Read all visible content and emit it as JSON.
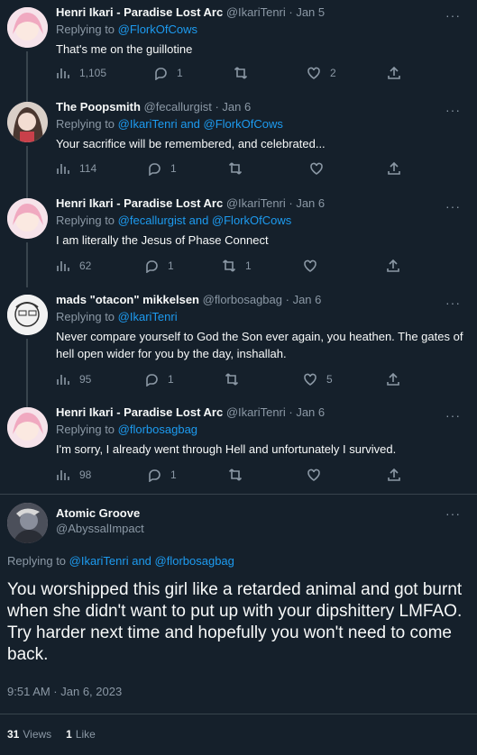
{
  "tweets": [
    {
      "name": "Henri Ikari - Paradise Lost Arc",
      "handle": "@IkariTenri",
      "date": "· Jan 5",
      "replying_to_prefix": "Replying to",
      "replying_to": "@FlorkOfCows",
      "text": "That's me on the guillotine",
      "views": "1,105",
      "replies": "1",
      "retweets": "",
      "likes": "2"
    },
    {
      "name": "The Poopsmith",
      "handle": "@fecallurgist",
      "date": "· Jan 6",
      "replying_to_prefix": "Replying to",
      "replying_to": "@IkariTenri and @FlorkOfCows",
      "text": "Your sacrifice will be remembered, and celebrated...",
      "views": "114",
      "replies": "1",
      "retweets": "",
      "likes": ""
    },
    {
      "name": "Henri Ikari - Paradise Lost Arc",
      "handle": "@IkariTenri",
      "date": "· Jan 6",
      "replying_to_prefix": "Replying to",
      "replying_to": "@fecallurgist and @FlorkOfCows",
      "text": "I am literally the Jesus of Phase Connect",
      "views": "62",
      "replies": "1",
      "retweets": "1",
      "likes": ""
    },
    {
      "name": "mads \"otacon\" mikkelsen",
      "handle": "@florbosagbag",
      "date": "· Jan 6",
      "replying_to_prefix": "Replying to",
      "replying_to": "@IkariTenri",
      "text": "Never compare yourself to God the Son ever again, you heathen. The gates of hell open wider for you by the day, inshallah.",
      "views": "95",
      "replies": "1",
      "retweets": "",
      "likes": "5"
    },
    {
      "name": "Henri Ikari - Paradise Lost Arc",
      "handle": "@IkariTenri",
      "date": "· Jan 6",
      "replying_to_prefix": "Replying to",
      "replying_to": "@florbosagbag",
      "text": "I'm sorry, I already went through Hell and unfortunately I survived.",
      "views": "98",
      "replies": "1",
      "retweets": "",
      "likes": ""
    }
  ],
  "main": {
    "name": "Atomic Groove",
    "handle": "@AbyssalImpact",
    "replying_to_prefix": "Replying to",
    "replying_to": "@IkariTenri and @florbosagbag",
    "text": "You worshipped this girl like a retarded animal and got burnt when she didn't want to put up with your dipshittery LMFAO. Try harder next time and hopefully you won't need to come back.",
    "timestamp": "9:51 AM · Jan 6, 2023",
    "views_count": "31",
    "views_label": "Views",
    "likes_count": "1",
    "likes_label": "Like"
  },
  "more_label": "···"
}
